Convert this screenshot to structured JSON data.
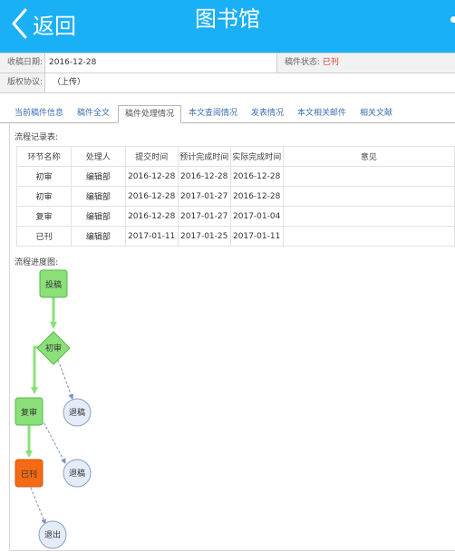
{
  "header": {
    "back_label": "返回",
    "title": "图书馆"
  },
  "info": {
    "date_label": "收稿日期:",
    "date_value": "2016-12-28",
    "status_label": "稿件状态:",
    "status_value": "已刊",
    "agreement_label": "版权协议:",
    "agreement_value": "（上传）"
  },
  "tabs": [
    {
      "label": "当前稿件信息"
    },
    {
      "label": "稿件全文"
    },
    {
      "label": "稿件处理情况"
    },
    {
      "label": "本文查阅情况"
    },
    {
      "label": "发表情况"
    },
    {
      "label": "本文相关邮件"
    },
    {
      "label": "相关文献"
    }
  ],
  "flow_record": {
    "label": "流程记录表:",
    "columns": [
      "环节名称",
      "处理人",
      "提交时间",
      "预计完成时间",
      "实际完成时间",
      "意见"
    ],
    "rows": [
      {
        "step": "初审",
        "handler": "编辑部",
        "submit": "2016-12-28",
        "expected": "2016-12-28",
        "actual": "2016-12-28",
        "opinion": ""
      },
      {
        "step": "初审",
        "handler": "编辑部",
        "submit": "2016-12-28",
        "expected": "2017-01-27",
        "actual": "2016-12-28",
        "opinion": ""
      },
      {
        "step": "复审",
        "handler": "编辑部",
        "submit": "2016-12-28",
        "expected": "2017-01-27",
        "actual": "2017-01-04",
        "opinion": ""
      },
      {
        "step": "已刊",
        "handler": "编辑部",
        "submit": "2017-01-11",
        "expected": "2017-01-25",
        "actual": "2017-01-11",
        "opinion": ""
      }
    ]
  },
  "flow_chart": {
    "label": "流程进度图:",
    "nodes": {
      "start": "投稿",
      "first_review": "初审",
      "return_1": "退稿",
      "second_review": "复审",
      "return_2": "退稿",
      "published": "已刊",
      "exit": "退出"
    },
    "colors": {
      "done_fill": "#8be07a",
      "done_stroke": "#55b845",
      "current_fill": "#f56a14",
      "current_stroke": "#d5570c",
      "pending_fill": "#e4ecf8",
      "pending_stroke": "#8aa0c6",
      "dashed_line": "#7a90bf"
    }
  }
}
